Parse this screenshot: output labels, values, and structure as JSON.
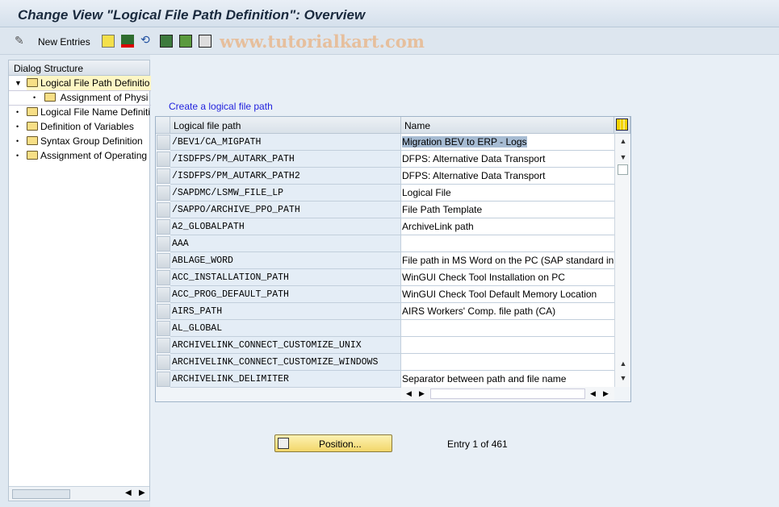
{
  "title": "Change View \"Logical File Path Definition\": Overview",
  "toolbar": {
    "new_entries": "New Entries",
    "watermark": "www.tutorialkart.com",
    "icons": [
      "edit-glasses-icon",
      "copy-icon",
      "delete-icon",
      "undo-icon",
      "select-all-icon",
      "select-block-icon",
      "deselect-all-icon"
    ]
  },
  "dialog": {
    "header": "Dialog Structure",
    "items": [
      {
        "label": "Logical File Path Definitio",
        "level": 0,
        "expanded": true,
        "selected": true
      },
      {
        "label": "Assignment of Physi",
        "level": 1
      },
      {
        "label": "Logical File Name Definiti",
        "level": 0
      },
      {
        "label": "Definition of Variables",
        "level": 0
      },
      {
        "label": "Syntax Group Definition",
        "level": 0
      },
      {
        "label": "Assignment of Operating",
        "level": 0
      }
    ]
  },
  "main": {
    "link": "Create a logical file path",
    "columns": [
      "Logical file path",
      "Name"
    ],
    "rows": [
      [
        "/BEV1/CA_MIGPATH",
        "Migration BEV to ERP - Logs"
      ],
      [
        "/ISDFPS/PM_AUTARK_PATH",
        "DFPS: Alternative Data Transport"
      ],
      [
        "/ISDFPS/PM_AUTARK_PATH2",
        "DFPS: Alternative Data Transport"
      ],
      [
        "/SAPDMC/LSMW_FILE_LP",
        "Logical File"
      ],
      [
        "/SAPPO/ARCHIVE_PPO_PATH",
        "File Path Template"
      ],
      [
        "A2_GLOBALPATH",
        "ArchiveLink path"
      ],
      [
        "AAA",
        ""
      ],
      [
        "ABLAGE_WORD",
        "File path in MS Word on the PC (SAP standard in"
      ],
      [
        "ACC_INSTALLATION_PATH",
        "WinGUI Check Tool Installation on PC"
      ],
      [
        "ACC_PROG_DEFAULT_PATH",
        "WinGUI Check Tool Default Memory Location"
      ],
      [
        "AIRS_PATH",
        "AIRS Workers' Comp. file path (CA)"
      ],
      [
        "AL_GLOBAL",
        ""
      ],
      [
        "ARCHIVELINK_CONNECT_CUSTOMIZE_UNIX",
        ""
      ],
      [
        "ARCHIVELINK_CONNECT_CUSTOMIZE_WINDOWS",
        ""
      ],
      [
        "ARCHIVELINK_DELIMITER",
        "Separator between path and file name"
      ]
    ],
    "position_button": "Position...",
    "entry_info": "Entry 1 of 461"
  }
}
